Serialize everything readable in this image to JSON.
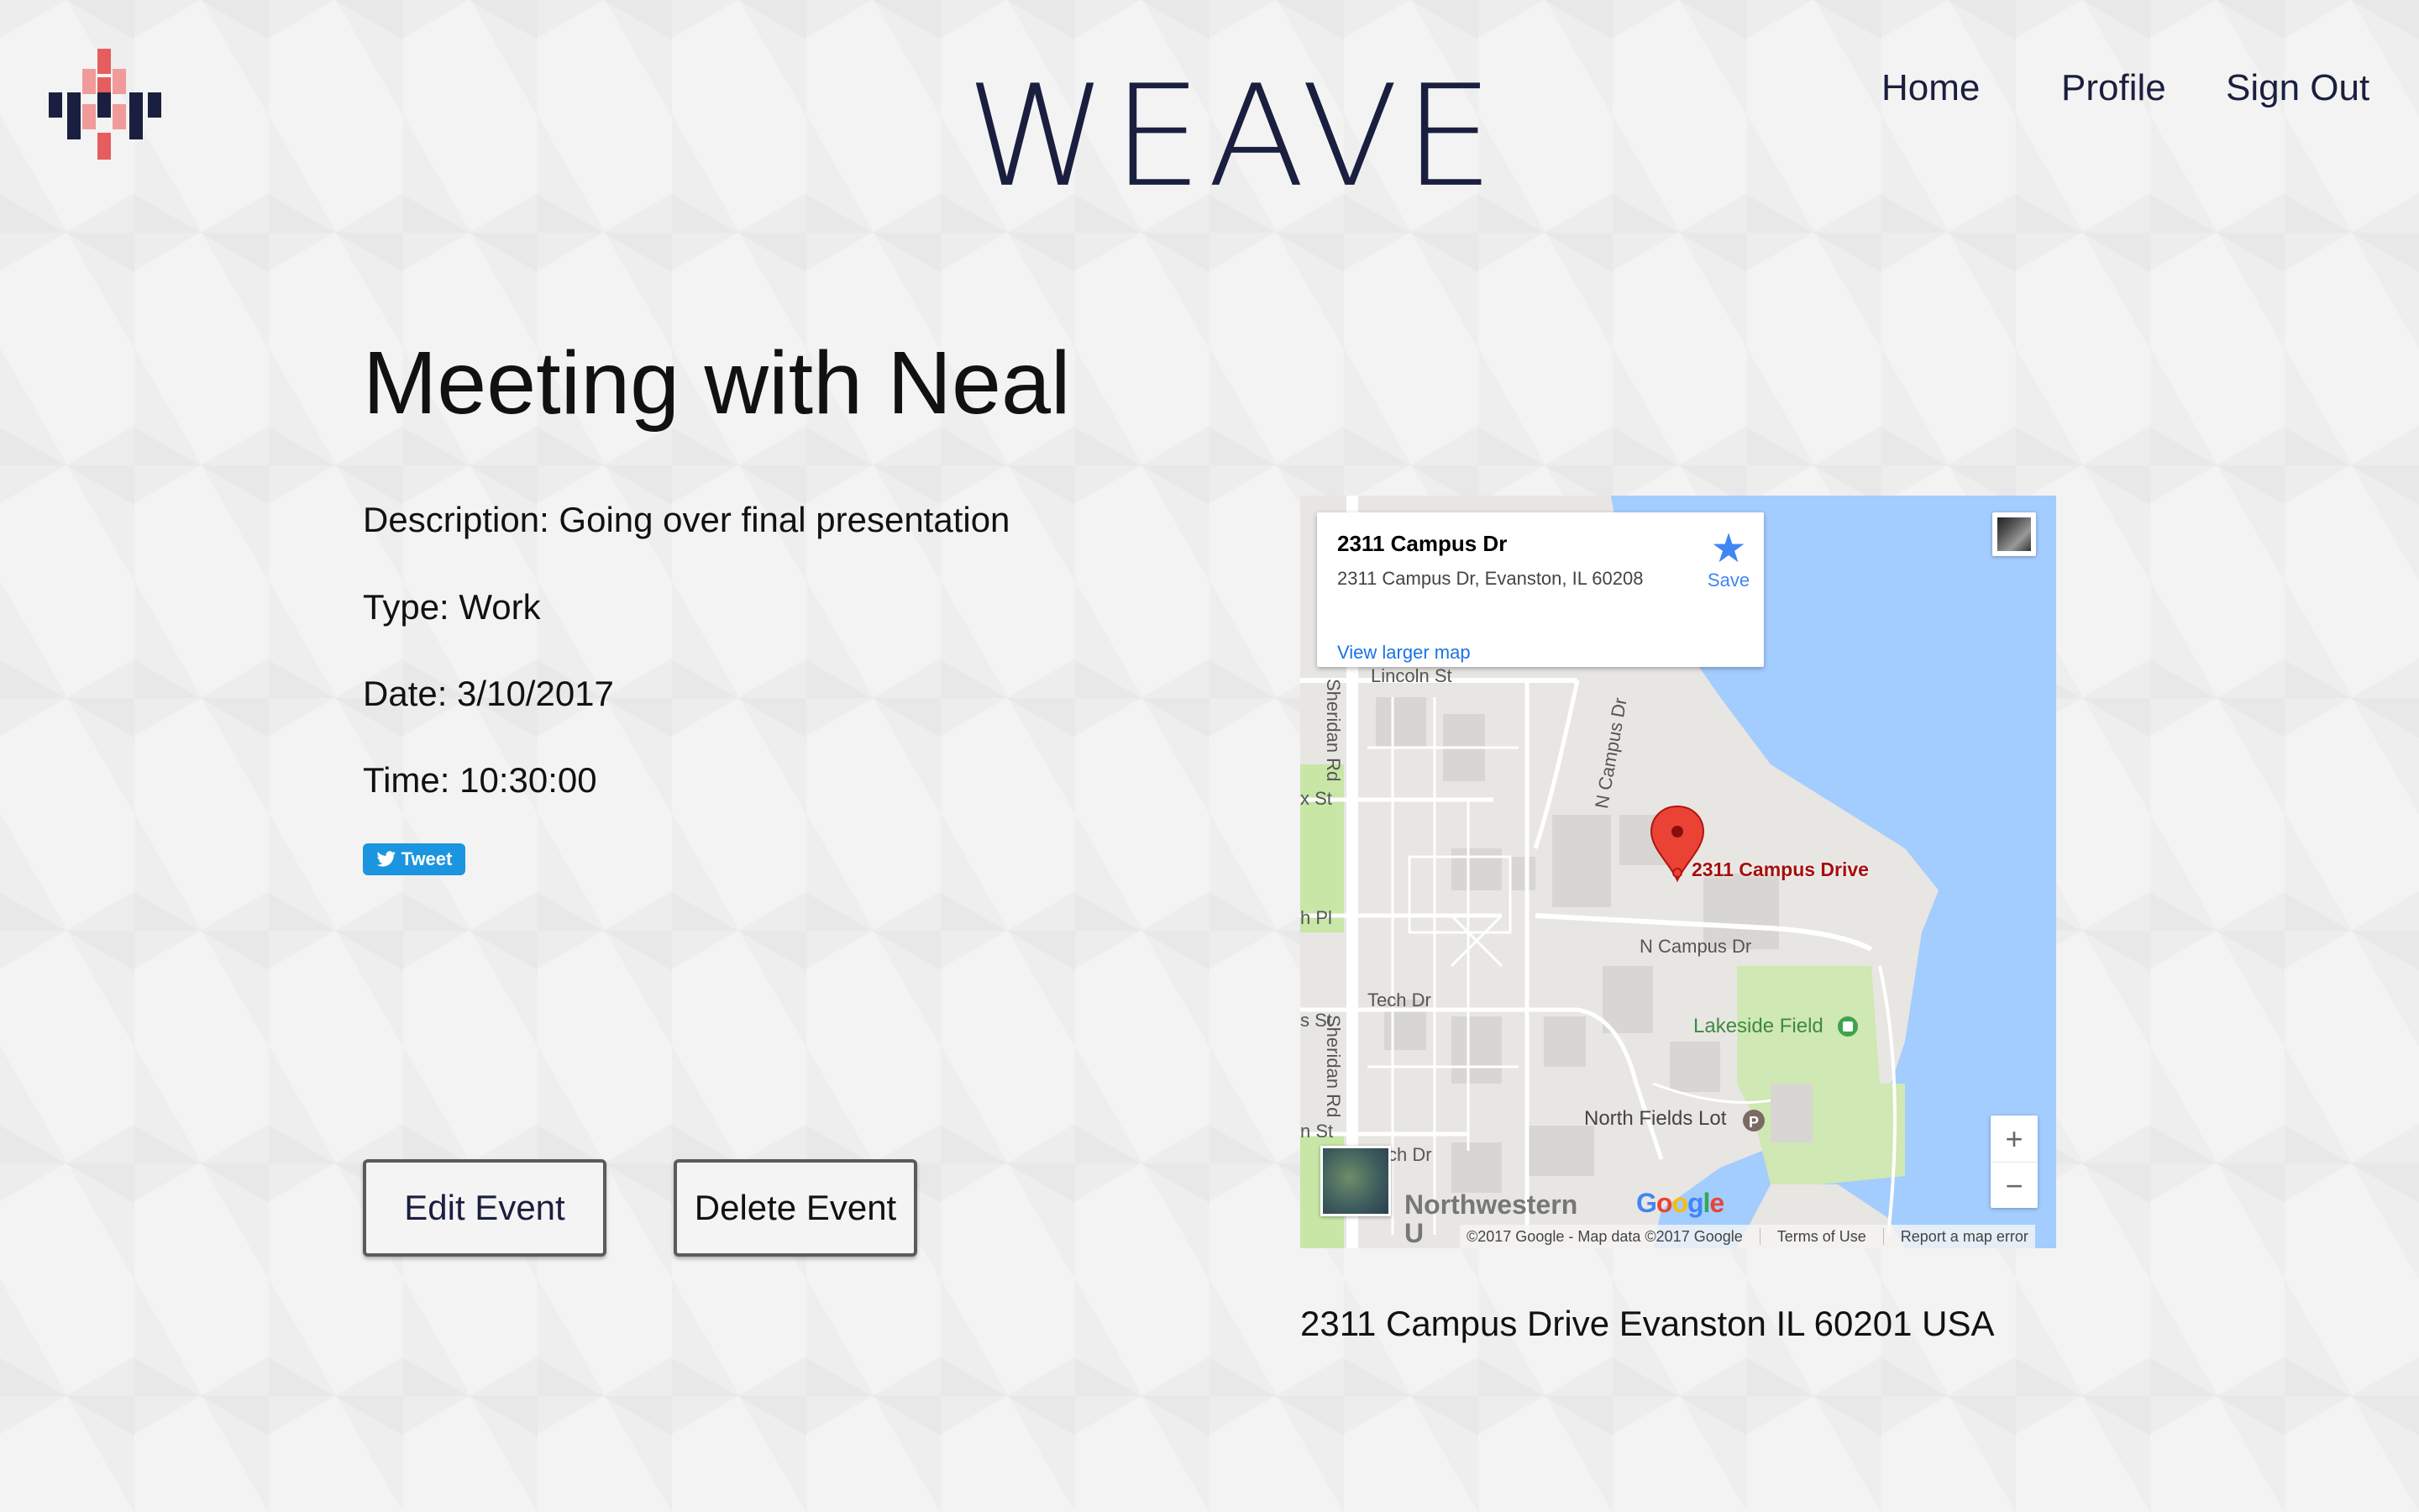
{
  "header": {
    "brand": "WEAVE",
    "nav": {
      "home": "Home",
      "profile": "Profile",
      "sign_out": "Sign Out"
    }
  },
  "event": {
    "title": "Meeting with Neal",
    "description": "Description: Going over final presentation",
    "type": "Type: Work",
    "date": "Date: 3/10/2017",
    "time": "Time: 10:30:00",
    "tweet_label": "Tweet",
    "edit_label": "Edit Event",
    "delete_label": "Delete Event",
    "address": "2311 Campus Drive Evanston IL 60201 USA"
  },
  "map": {
    "info": {
      "title": "2311 Campus Dr",
      "address": "2311 Campus Dr, Evanston, IL 60208",
      "save_label": "Save",
      "larger_map_label": "View larger map"
    },
    "pin_label": "2311 Campus Drive",
    "streets": {
      "lincoln": "Lincoln St",
      "sheridan_top": "Sheridan Rd",
      "n_campus_vertical": "N Campus Dr",
      "x_st": "x St",
      "h_pl": "h Pl",
      "s_st": "s St",
      "n_st": "n St",
      "n_campus_horizontal": "N Campus Dr",
      "tech": "Tech Dr",
      "sheridan_bottom": "Sheridan Rd",
      "ch_dr": "ch Dr",
      "north_fields": "North Fields Lot",
      "northwestern": "Northwestern",
      "u": "U"
    },
    "lakeside": "Lakeside Field",
    "zoom_in": "+",
    "zoom_out": "−",
    "google": "Google",
    "attribution": {
      "data": "©2017 Google - Map data ©2017 Google",
      "terms": "Terms of Use",
      "report": "Report a map error"
    },
    "colors": {
      "water": "#a3ccff",
      "land": "#e8e6e2",
      "park": "#c8e6a6",
      "road": "#ffffff",
      "pin": "#ea4335"
    }
  }
}
